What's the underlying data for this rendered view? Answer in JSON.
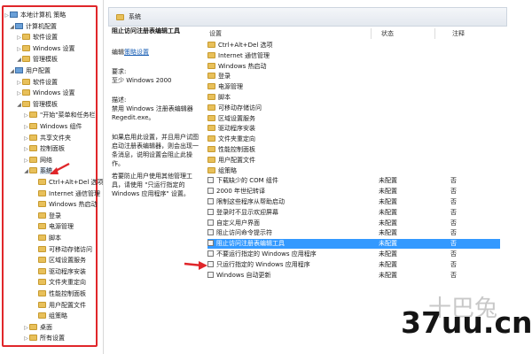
{
  "tree": {
    "items": [
      {
        "label": "本地计算机 策略",
        "level": 0,
        "icon": "computer-icon"
      },
      {
        "label": "计算机配置",
        "level": 1,
        "icon": "computer-icon"
      },
      {
        "label": "软件设置",
        "level": 2,
        "icon": "folder-icon"
      },
      {
        "label": "Windows 设置",
        "level": 2,
        "icon": "folder-icon"
      },
      {
        "label": "管理模板",
        "level": 2,
        "icon": "folder-icon"
      },
      {
        "label": "用户配置",
        "level": 1,
        "icon": "computer-icon"
      },
      {
        "label": "软件设置",
        "level": 2,
        "icon": "folder-icon"
      },
      {
        "label": "Windows 设置",
        "level": 2,
        "icon": "folder-icon"
      },
      {
        "label": "管理模板",
        "level": 2,
        "icon": "folder-icon"
      },
      {
        "label": "\"开始\"菜单和任务栏",
        "level": 3,
        "icon": "folder-icon"
      },
      {
        "label": "Windows 组件",
        "level": 3,
        "icon": "folder-icon"
      },
      {
        "label": "共享文件夹",
        "level": 3,
        "icon": "folder-icon"
      },
      {
        "label": "控制面板",
        "level": 3,
        "icon": "folder-icon"
      },
      {
        "label": "网络",
        "level": 3,
        "icon": "folder-icon"
      },
      {
        "label": "系统",
        "level": 3,
        "icon": "folder-icon"
      },
      {
        "label": "Ctrl+Alt+Del 选项",
        "level": 4,
        "icon": "folder-icon"
      },
      {
        "label": "Internet 通信管理",
        "level": 4,
        "icon": "folder-icon"
      },
      {
        "label": "Windows 热启动",
        "level": 4,
        "icon": "folder-icon"
      },
      {
        "label": "登录",
        "level": 4,
        "icon": "folder-icon"
      },
      {
        "label": "电源管理",
        "level": 4,
        "icon": "folder-icon"
      },
      {
        "label": "脚本",
        "level": 4,
        "icon": "folder-icon"
      },
      {
        "label": "可移动存储访问",
        "level": 4,
        "icon": "folder-icon"
      },
      {
        "label": "区域设置服务",
        "level": 4,
        "icon": "folder-icon"
      },
      {
        "label": "驱动程序安装",
        "level": 4,
        "icon": "folder-icon"
      },
      {
        "label": "文件夹重定向",
        "level": 4,
        "icon": "folder-icon"
      },
      {
        "label": "性能控制面板",
        "level": 4,
        "icon": "folder-icon"
      },
      {
        "label": "用户配置文件",
        "level": 4,
        "icon": "folder-icon"
      },
      {
        "label": "组策略",
        "level": 4,
        "icon": "folder-icon"
      },
      {
        "label": "桌面",
        "level": 3,
        "icon": "folder-icon"
      },
      {
        "label": "所有设置",
        "level": 3,
        "icon": "folder-icon"
      }
    ]
  },
  "header": {
    "title": "系统"
  },
  "description": {
    "policy_title": "阻止访问注册表编辑工具",
    "edit_prefix": "编辑",
    "edit_link": "策略设置",
    "requirements_label": "要求:",
    "requirements_value": "至少 Windows 2000",
    "desc_label": "描述:",
    "desc_line1": "禁用 Windows 注册表编辑器",
    "desc_line2": "Regedit.exe。",
    "para1": "如果启用此设置，并且用户试图启动注册表编辑器，则会出现一条消息，说明设置会阻止此操作。",
    "para2": "若要防止用户使用其他管理工具，请使用 \"只运行指定的 Windows 应用程序\" 设置。"
  },
  "list": {
    "columns": {
      "name": "设置",
      "state": "状态",
      "note": "注释"
    },
    "folders": [
      "Ctrl+Alt+Del 选项",
      "Internet 通信管理",
      "Windows 热启动",
      "登录",
      "电源管理",
      "脚本",
      "可移动存储访问",
      "区域设置服务",
      "驱动程序安装",
      "文件夹重定向",
      "性能控制面板",
      "用户配置文件",
      "组策略"
    ],
    "policies": [
      {
        "name": "下载缺少的 COM 组件",
        "state": "未配置",
        "note": "否"
      },
      {
        "name": "2000 年世纪转译",
        "state": "未配置",
        "note": "否"
      },
      {
        "name": "限制这些程序从帮助启动",
        "state": "未配置",
        "note": "否"
      },
      {
        "name": "登录时不显示欢迎屏幕",
        "state": "未配置",
        "note": "否"
      },
      {
        "name": "自定义用户界面",
        "state": "未配置",
        "note": "否"
      },
      {
        "name": "阻止访问命令提示符",
        "state": "未配置",
        "note": "否"
      },
      {
        "name": "阻止访问注册表编辑工具",
        "state": "未配置",
        "note": "否",
        "selected": true
      },
      {
        "name": "不要运行指定的 Windows 应用程序",
        "state": "未配置",
        "note": "否"
      },
      {
        "name": "只运行指定的 Windows 应用程序",
        "state": "未配置",
        "note": "否"
      },
      {
        "name": "Windows 自动更新",
        "state": "未配置",
        "note": "否"
      }
    ]
  },
  "watermark": {
    "text": "37uu.cn",
    "faint_text": "十巴兔"
  },
  "colors": {
    "selection": "#3399ff",
    "annotation_red": "#e0262a",
    "folder": "#e8c05a"
  }
}
